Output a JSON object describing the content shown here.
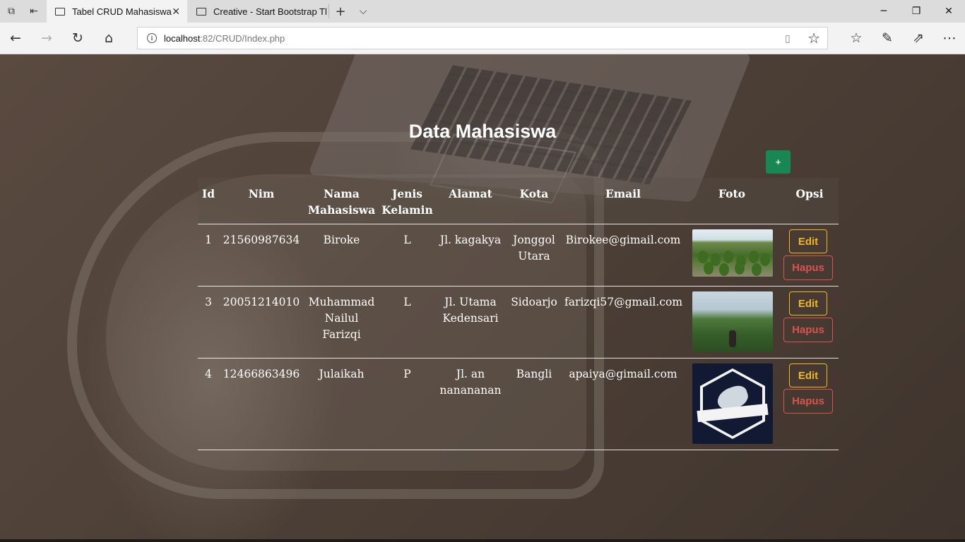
{
  "browser": {
    "tabs": [
      {
        "label": "Tabel CRUD Mahasiswa",
        "active": true
      },
      {
        "label": "Creative - Start Bootstrap Tl",
        "active": false
      }
    ],
    "url_host": "localhost",
    "url_rest": ":82/CRUD/Index.php",
    "new_tab_glyph": "+",
    "tab_list_glyph": "⌵"
  },
  "page": {
    "title": "Data Mahasiswa",
    "add_button": "+"
  },
  "table": {
    "headers": {
      "id": "Id",
      "nim": "Nim",
      "nama": "Nama Mahasiswa",
      "jk": "Jenis Kelamin",
      "alamat": "Alamat",
      "kota": "Kota",
      "email": "Email",
      "foto": "Foto",
      "opsi": "Opsi"
    },
    "rows": [
      {
        "id": "1",
        "nim": "21560987634",
        "nama": "Biroke",
        "jk": "L",
        "alamat": "Jl. kagakya",
        "kota": "Jonggol Utara",
        "email": "Birokee@gimail.com",
        "foto": "plant-nursery-photo"
      },
      {
        "id": "3",
        "nim": "20051214010",
        "nama": "Muhammad Nailul Farizqi",
        "jk": "L",
        "alamat": "Jl. Utama Kedensari",
        "kota": "Sidoarjo",
        "email": "farizqi57@gmail.com",
        "foto": "hill-landscape-photo"
      },
      {
        "id": "4",
        "nim": "12466863496",
        "nama": "Julaikah",
        "jk": "P",
        "alamat": "Jl. an nanananan",
        "kota": "Bangli",
        "email": "apaiya@gimail.com",
        "foto": "informatics-logo"
      }
    ],
    "edit_label": "Edit",
    "delete_label": "Hapus"
  },
  "colors": {
    "add_button": "#198754",
    "edit": "#f2b822",
    "delete": "#d9534f"
  }
}
